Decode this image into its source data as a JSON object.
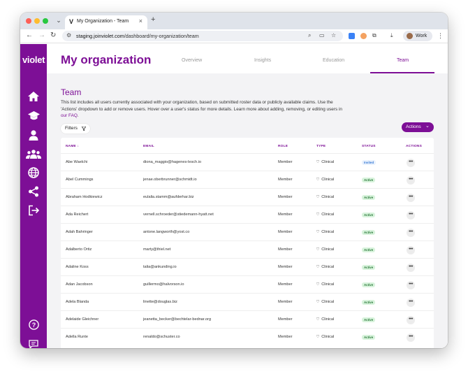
{
  "browser": {
    "tab_title": "My Organization - Team",
    "url_host": "staging.joinvioletcom",
    "url_display_host": "staging.joinviolet.com",
    "url_path": "/dashboard/my-organization/team",
    "profile_label": "Work"
  },
  "sidebar": {
    "logo": "violet",
    "items": [
      {
        "icon": "home-icon"
      },
      {
        "icon": "graduation-cap-icon"
      },
      {
        "icon": "user-icon"
      },
      {
        "icon": "team-icon"
      },
      {
        "icon": "globe-icon"
      },
      {
        "icon": "share-icon"
      },
      {
        "icon": "logout-icon"
      }
    ],
    "bottom": [
      {
        "icon": "help-icon"
      },
      {
        "icon": "feedback-icon"
      }
    ]
  },
  "header": {
    "title": "My organization",
    "tabs": [
      "Overview",
      "Insights",
      "Education",
      "Team"
    ],
    "active_tab": "Team"
  },
  "team": {
    "title": "Team",
    "description_1": "This list includes all users currently associated with your organization, based on submitted roster data or publicly available claims. Use the 'Actions' dropdown to add or remove users. Hover over a user's status for more details. Learn more about adding, removing, or editing users in ",
    "description_link": "our FAQ",
    "description_end": ".",
    "filters_label": "Filters",
    "actions_label": "Actions"
  },
  "table": {
    "headers": [
      "NAME",
      "EMAIL",
      "ROLE",
      "TYPE",
      "STATUS",
      "ACTIONS"
    ],
    "rows": [
      {
        "name": "Abe Waelchi",
        "email": "diona_maggio@hagenes-lesch.io",
        "role": "Member",
        "type": "Clinical",
        "status": "Invited"
      },
      {
        "name": "Abel Cummings",
        "email": "jenae.oberbrunner@schmidt.io",
        "role": "Member",
        "type": "Clinical",
        "status": "Active"
      },
      {
        "name": "Abraham Hodkiewicz",
        "email": "eulalia.stamm@aufderhar.biz",
        "role": "Member",
        "type": "Clinical",
        "status": "Active"
      },
      {
        "name": "Ada Reichert",
        "email": "vernell.schroeder@stiedemann-hyatt.net",
        "role": "Member",
        "type": "Clinical",
        "status": "Active"
      },
      {
        "name": "Adah Bahringer",
        "email": "antone.langworth@yost.co",
        "role": "Member",
        "type": "Clinical",
        "status": "Active"
      },
      {
        "name": "Adalberto Ortiz",
        "email": "marty@thiel.net",
        "role": "Member",
        "type": "Clinical",
        "status": "Active"
      },
      {
        "name": "Adaline Koss",
        "email": "talia@ankunding.io",
        "role": "Member",
        "type": "Clinical",
        "status": "Active"
      },
      {
        "name": "Adan Jacobson",
        "email": "guillermo@halvorson.io",
        "role": "Member",
        "type": "Clinical",
        "status": "Active"
      },
      {
        "name": "Adela Blanda",
        "email": "linette@douglas.biz",
        "role": "Member",
        "type": "Clinical",
        "status": "Active"
      },
      {
        "name": "Adelaide Gleichner",
        "email": "jeanetta_becker@bechtelar-bednar.org",
        "role": "Member",
        "type": "Clinical",
        "status": "Active"
      },
      {
        "name": "Adella Runte",
        "email": "renaldo@schuster.co",
        "role": "Member",
        "type": "Clinical",
        "status": "Active"
      }
    ]
  },
  "colors": {
    "brand": "#7d0f96",
    "active_badge": "#d8f3dc",
    "invited_badge": "#eaf2fd"
  }
}
